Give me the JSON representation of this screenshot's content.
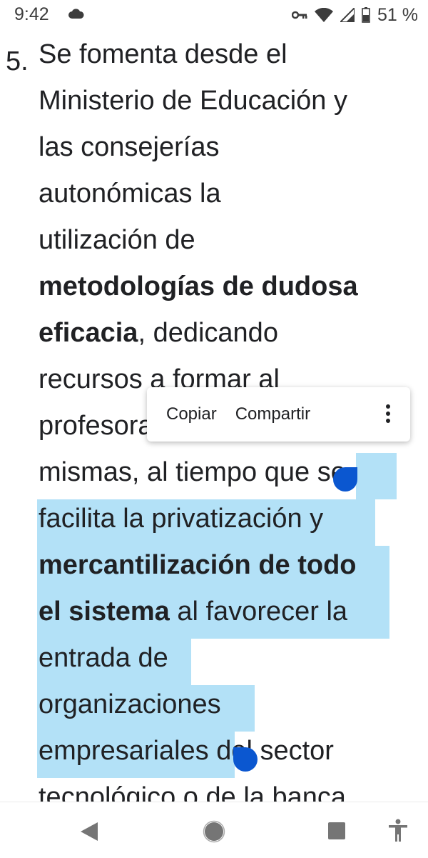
{
  "status_bar": {
    "time": "9:42",
    "battery": "51 %",
    "icons": [
      "cloud-icon",
      "vpn-key-icon",
      "wifi-icon",
      "signal-icon",
      "battery-icon"
    ]
  },
  "article": {
    "list_number": "5.",
    "lines": [
      "Se fomenta desde el",
      "Ministerio de Educación y",
      "las consejerías",
      "autonómicas la",
      "utilización de",
      "metodologías de dudosa",
      "eficacia",
      ", dedicando",
      "recursos a formar al",
      "profesorado en las",
      "mismas, al tiempo que ",
      "se",
      "facilita la privatización y",
      "mercantilización de todo",
      "el sistema",
      " al favorecer la",
      "entrada de",
      "organizaciones",
      "empresariales",
      " del sector",
      "tecnológico o de la banca"
    ]
  },
  "context_menu": {
    "copy": "Copiar",
    "share": "Compartir"
  },
  "nav_bar": {
    "icons": [
      "back-icon",
      "home-icon",
      "recents-icon",
      "accessibility-icon"
    ]
  },
  "colors": {
    "selection": "#b3e1f7",
    "handle": "#0b57d0",
    "text": "#202124"
  }
}
